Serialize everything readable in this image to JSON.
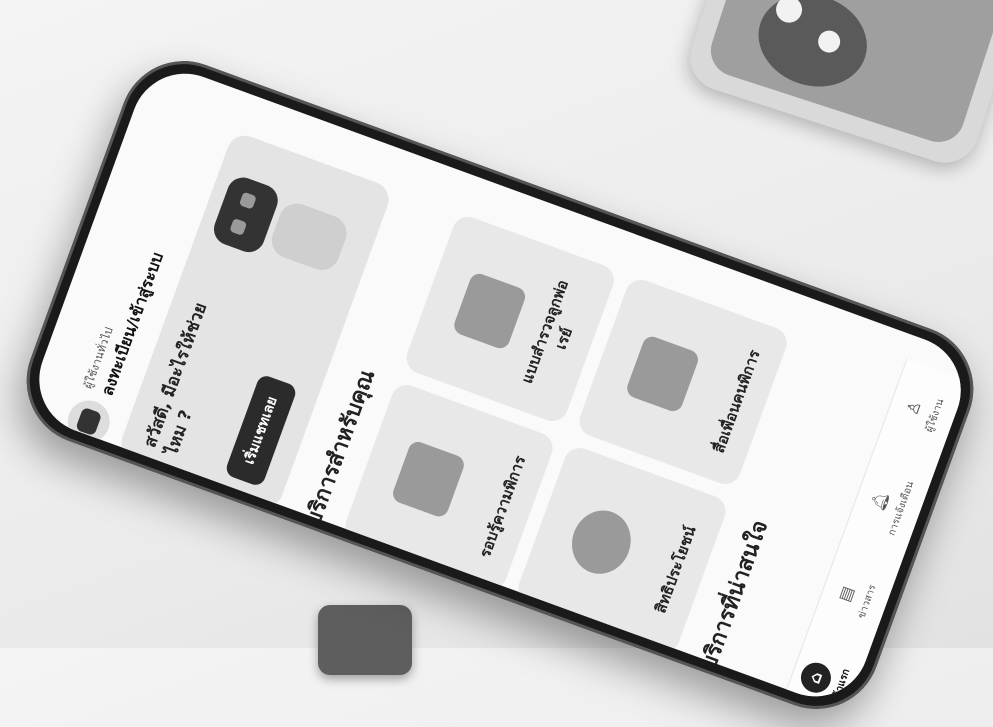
{
  "greeting": {
    "small": "ผู้ใช้งานทั่วไป",
    "big": "ลงทะเบียน/เข้าสู่ระบบ"
  },
  "hero": {
    "text": "สวัสดี, มีอะไรให้ช่วยไหม ?",
    "button": "เริ่มแชทเลย"
  },
  "sections": {
    "services_for_you": "บริการสำหรับคุณ",
    "interesting": "บริการที่น่าสนใจ"
  },
  "cards": [
    {
      "label": "รอบรู้ความพิการ",
      "icon": "book-icon"
    },
    {
      "label": "แบบสำรวจลูกพ่อเรย์",
      "icon": "survey-icon"
    },
    {
      "label": "สิทธิประโยชน์",
      "icon": "star-badge-icon"
    },
    {
      "label": "สื่อเพื่อนคนพิการ",
      "icon": "media-icon"
    }
  ],
  "nav": [
    {
      "label": "หน้าแรก",
      "icon": "home-icon",
      "active": true
    },
    {
      "label": "ข่าวสาร",
      "icon": "news-icon",
      "active": false
    },
    {
      "label": "การแจ้งเตือน",
      "icon": "bell-icon",
      "active": false
    },
    {
      "label": "ผู้ใช้งาน",
      "icon": "user-icon",
      "active": false
    }
  ]
}
